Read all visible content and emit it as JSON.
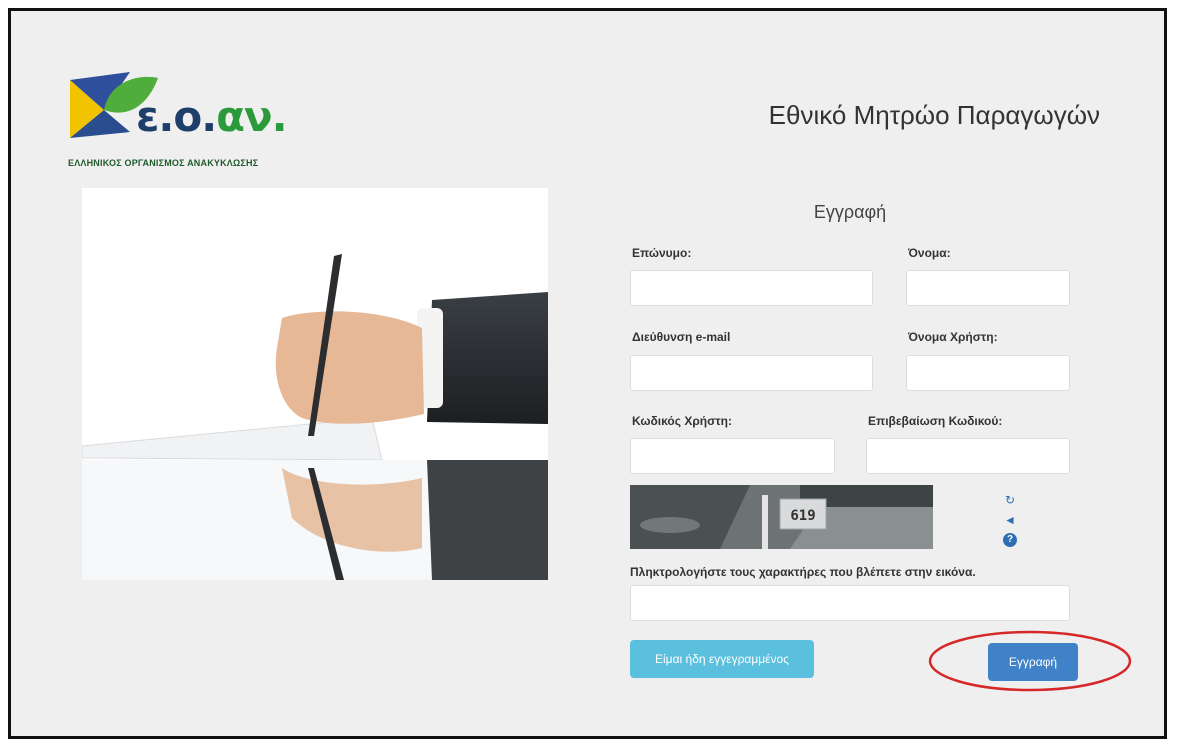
{
  "logo": {
    "text_main": "ε.ο.",
    "text_accent": "αν.",
    "subtitle": "ΕΛΛΗΝΙΚΟΣ ΟΡΓΑΝΙΣΜΟΣ ΑΝΑΚΥΚΛΩΣΗΣ"
  },
  "app_title": "Εθνικό Μητρώο Παραγωγών",
  "form": {
    "title": "Εγγραφή",
    "fields": {
      "surname_label": "Επώνυμο:",
      "name_label": "Όνομα:",
      "email_label": "Διεύθυνση e-mail",
      "username_label": "Όνομα Χρήστη:",
      "password_label": "Κωδικός Χρήστη:",
      "confirm_label": "Επιβεβαίωση Κωδικού:"
    },
    "captcha": {
      "image_number": "619",
      "instruction": "Πληκτρολογήστε τους χαρακτήρες που βλέπετε στην εικόνα.",
      "icons": [
        "refresh-icon",
        "audio-icon",
        "help-icon"
      ]
    },
    "buttons": {
      "already_registered": "Είμαι ήδη εγγεγραμμένος",
      "register": "Εγγραφή"
    }
  },
  "colors": {
    "logo_blue": "#1f3f6b",
    "logo_green": "#2b9a3a",
    "logo_yellow": "#f2c300",
    "btn_info": "#5bc0de",
    "btn_primary": "#3f82c8",
    "highlight_red": "#d62828"
  }
}
